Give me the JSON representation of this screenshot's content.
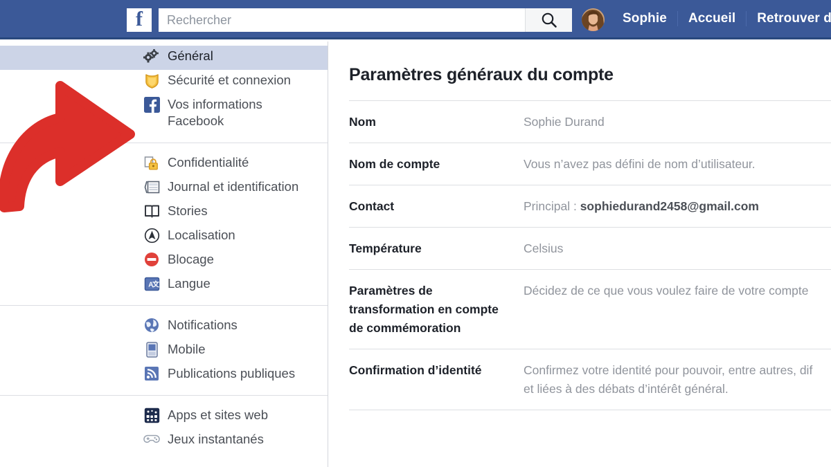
{
  "topbar": {
    "logo_icon": "facebook-logo-icon",
    "search": {
      "placeholder": "Rechercher",
      "value": "",
      "button_icon": "search-icon"
    },
    "profile_name": "Sophie",
    "avatar_icon": "user-avatar",
    "nav_items": [
      {
        "label": "Accueil"
      },
      {
        "label": "Retrouver des"
      }
    ],
    "bar_color": "#3b5998"
  },
  "sidebar": {
    "groups": [
      {
        "items": [
          {
            "label": "Général",
            "icon": "gears-icon",
            "active": true
          },
          {
            "label": "Sécurité et connexion",
            "icon": "shield-icon",
            "active": false
          },
          {
            "label": "Vos informations\nFacebook",
            "icon": "facebook-square-icon",
            "active": false,
            "tall": true
          }
        ]
      },
      {
        "items": [
          {
            "label": "Confidentialité",
            "icon": "lock-icon",
            "active": false
          },
          {
            "label": "Journal et identification",
            "icon": "timeline-icon",
            "active": false
          },
          {
            "label": "Stories",
            "icon": "book-icon",
            "active": false
          },
          {
            "label": "Localisation",
            "icon": "location-icon",
            "active": false
          },
          {
            "label": "Blocage",
            "icon": "block-icon",
            "active": false
          },
          {
            "label": "Langue",
            "icon": "language-icon",
            "active": false
          }
        ]
      },
      {
        "items": [
          {
            "label": "Notifications",
            "icon": "globe-icon",
            "active": false
          },
          {
            "label": "Mobile",
            "icon": "mobile-icon",
            "active": false
          },
          {
            "label": "Publications publiques",
            "icon": "rss-icon",
            "active": false
          }
        ]
      },
      {
        "items": [
          {
            "label": "Apps et sites web",
            "icon": "apps-grid-icon",
            "active": false
          },
          {
            "label": "Jeux instantanés",
            "icon": "gamepad-icon",
            "active": false
          }
        ]
      }
    ]
  },
  "main": {
    "title": "Paramètres généraux du compte",
    "rows": [
      {
        "label": "Nom",
        "value": "Sophie Durand",
        "value_prefix": "",
        "value_strong": ""
      },
      {
        "label": "Nom de compte",
        "value": "Vous n’avez pas défini de nom d’utilisateur.",
        "value_prefix": "",
        "value_strong": ""
      },
      {
        "label": "Contact",
        "value": "",
        "value_prefix": "Principal : ",
        "value_strong": "sophiedurand2458@gmail.com"
      },
      {
        "label": "Température",
        "value": "Celsius",
        "value_prefix": "",
        "value_strong": ""
      },
      {
        "label": "Paramètres de\ntransformation en compte\nde commémoration",
        "value": "Décidez de ce que vous voulez faire de votre compte",
        "value_prefix": "",
        "value_strong": ""
      },
      {
        "label": "Confirmation d’identité",
        "value": "Confirmez votre identité pour pouvoir, entre autres, dif\net liées à des débats d’intérêt général.",
        "value_prefix": "",
        "value_strong": ""
      }
    ]
  },
  "annotation": {
    "arrow_icon": "curved-red-arrow-icon",
    "arrow_color": "#dc2f2a",
    "points_at": "Vos informations Facebook"
  }
}
